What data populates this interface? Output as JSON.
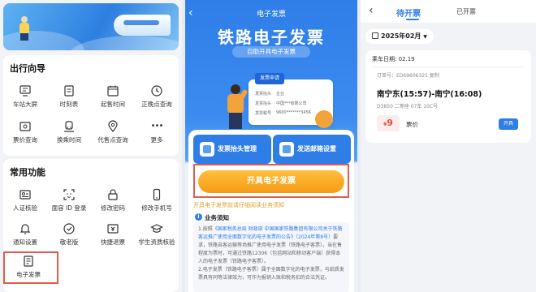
{
  "panel1": {
    "travel_section": {
      "title": "出行向导",
      "items": [
        {
          "label": "车站大屏",
          "icon": "station-screen-icon"
        },
        {
          "label": "时刻表",
          "icon": "timetable-icon"
        },
        {
          "label": "起售时间",
          "icon": "sale-time-icon"
        },
        {
          "label": "正晚点查询",
          "icon": "clock-icon"
        },
        {
          "label": "票价查询",
          "icon": "fare-query-icon"
        },
        {
          "label": "换乘时间",
          "icon": "transfer-icon"
        },
        {
          "label": "代售点查询",
          "icon": "agency-location-icon"
        },
        {
          "label": "更多",
          "icon": "more-icon",
          "glyph": "•••"
        }
      ]
    },
    "common_section": {
      "title": "常用功能",
      "items": [
        {
          "label": "人证核验",
          "icon": "id-verify-icon"
        },
        {
          "label": "面容 ID 登录",
          "icon": "face-id-icon"
        },
        {
          "label": "修改密码",
          "icon": "lock-icon"
        },
        {
          "label": "修改手机号",
          "icon": "phone-icon"
        },
        {
          "label": "通知设置",
          "icon": "bell-icon"
        },
        {
          "label": "敬老版",
          "icon": "elder-icon"
        },
        {
          "label": "快捷退票",
          "icon": "refund-icon"
        },
        {
          "label": "学生资质核验",
          "icon": "student-icon"
        },
        {
          "label": "电子发票",
          "icon": "e-invoice-icon"
        }
      ]
    }
  },
  "panel2": {
    "back_glyph": "‹",
    "title": "电子发票",
    "big_title": "铁路电子发票",
    "subtitle": "自助开具电子发票",
    "invoice_mock": {
      "head": "发票申请",
      "row1_label": "发票抬头",
      "row1_value": "企业",
      "row2_label": "发票抬头",
      "row2_value": "中国***有限公司",
      "row3_label": "发票税号",
      "row3_value": "9600*******3456"
    },
    "tile_left": "发票抬头管理",
    "tile_right": "发送邮箱设置",
    "open_button": "开具电子发票",
    "notice_link": "开具电子发票前请仔细阅读业务须知",
    "notice_title": "业务须知",
    "notice_paragraph1_pre": "1.按照",
    "notice_paragraph1_link": "《国家税务总局 财政部 中国国家铁路集团有限公司关于铁路客运推广使用全面数字化的电子发票的公告》（2024年第8号）",
    "notice_paragraph1_post": "要求，铁路自客运输等场推广使用电子发票（铁路电子客票）。当在售程度为票时，可通过铁路12306（包括网站和移动客户端）获得本人的电子发票（铁路电子客票）。",
    "notice_paragraph2": "2.电子发票（铁路电子客票）属于全面数字化的电子发票，与纸质发票具有同等法律效力，可作为报销入账和税务扣的合法凭证。"
  },
  "panel3": {
    "back_glyph": "‹",
    "tab_active": "待开票",
    "tab_other": "已开票",
    "month": "2025年02月",
    "ride_date": "乘车日期: 02.19",
    "order": "订单号：ED69606321 复制",
    "route": "南宁东(15:57)-南宁(16:08)",
    "train_info": "D3850 二等座 07车 10C号",
    "price_symbol": "¥",
    "price": "9",
    "price_label": "票价",
    "issue_button": "开具"
  },
  "colors": {
    "accent": "#2f7ee8",
    "highlight_box": "#e35b4b",
    "primary_button": "#f59b16",
    "price": "#e34c3c"
  }
}
